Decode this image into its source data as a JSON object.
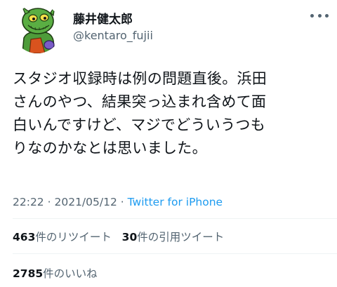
{
  "author": {
    "display_name": "藤井健太郎",
    "handle": "@kentaro_fujii",
    "avatar_icon": "green-monster-cartoon-avatar"
  },
  "tweet": {
    "text": "スタジオ収録時は例の問題直後。浜田\nさんのやつ、結果突っ込まれ含めて面\n白いんですけど、マジでどういうつも\nりなのかなとは思いました。",
    "time": "22:22",
    "separator": "·",
    "date": "2021/05/12",
    "source": "Twitter for iPhone"
  },
  "stats": {
    "retweets_count": "463",
    "retweets_label": "件のリツイート",
    "quotes_count": "30",
    "quotes_label": "件の引用ツイート",
    "likes_count": "2785",
    "likes_label": "件のいいね"
  },
  "colors": {
    "text": "#0f1419",
    "secondary": "#536471",
    "link": "#1d9bf0",
    "avatar_green": "#4e9c3a"
  }
}
